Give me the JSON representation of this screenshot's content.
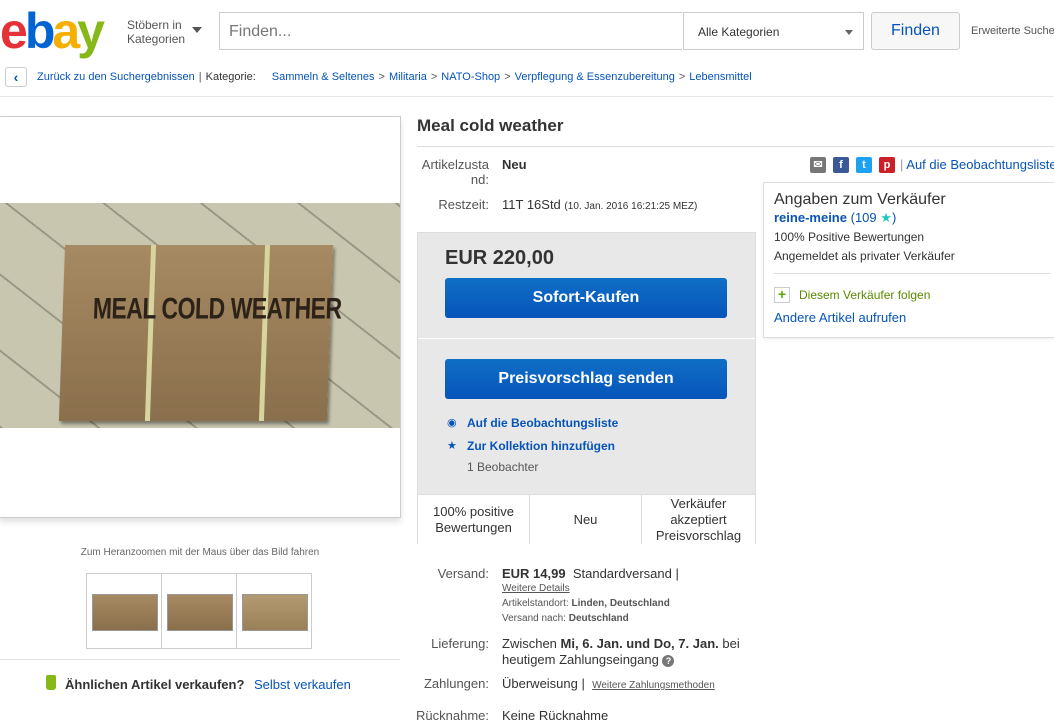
{
  "header": {
    "browse_label_1": "Stöbern in",
    "browse_label_2": "Kategorien",
    "search_placeholder": "Finden...",
    "category_select": "Alle Kategorien",
    "find_button": "Finden",
    "advanced_link": "Erweiterte Suche"
  },
  "breadcrumb": {
    "back_link": "Zurück zu den Suchergebnissen",
    "category_label": "Kategorie:",
    "items": [
      "Sammeln & Seltenes",
      "Militaria",
      "NATO-Shop",
      "Verpflegung & Essenzubereitung",
      "Lebensmittel"
    ]
  },
  "gallery": {
    "main_image_text": "MEAL  COLD WEATHER",
    "zoom_hint": "Zum Heranzoomen mit der Maus über das Bild fahren",
    "sell_similar_label": "Ähnlichen Artikel verkaufen?",
    "sell_link": "Selbst verkaufen"
  },
  "item": {
    "title": "Meal cold weather",
    "condition_label_1": "Artikelzusta",
    "condition_label_2": "nd:",
    "condition_value": "Neu",
    "time_label": "Restzeit:",
    "time_value": "11T 16Std",
    "time_detail": "(10. Jan. 2016   16:21:25 MEZ)",
    "watchlist_link": "Auf die Beobachtungsliste"
  },
  "buybox": {
    "price": "EUR 220,00",
    "buy_now": "Sofort-Kaufen",
    "make_offer": "Preisvorschlag senden",
    "watch_link": "Auf die Beobachtungsliste",
    "collection_link": "Zur Kollektion hinzufügen",
    "watchers": "1 Beobachter",
    "features": [
      "100% positive Bewertungen",
      "Neu",
      "Verkäufer akzeptiert Preisvorschlag"
    ]
  },
  "seller": {
    "title": "Angaben zum Verkäufer",
    "name": "reine-meine",
    "feedback_count": "109",
    "positive": "100% Positive Bewertungen",
    "registered": "Angemeldet als privater Verkäufer",
    "follow": "Diesem Verkäufer folgen",
    "other_items": "Andere Artikel aufrufen"
  },
  "shipping": {
    "label": "Versand:",
    "price": "EUR 14,99",
    "type": "Standardversand |",
    "details_link": "Weitere Details",
    "location_label": "Artikelstandort:",
    "location": "Linden, Deutschland",
    "ship_to_label": "Versand nach:",
    "ship_to": "Deutschland",
    "delivery_label": "Lieferung:",
    "delivery_1": "Zwischen",
    "delivery_dates": "Mi, 6. Jan. und Do, 7. Jan.",
    "delivery_2": "bei",
    "delivery_3": "heutigem Zahlungseingang",
    "payment_label": "Zahlungen:",
    "payment_value": "Überweisung |",
    "payment_link": "Weitere Zahlungsmethoden",
    "returns_label": "Rücknahme:",
    "returns_value": "Keine Rücknahme"
  },
  "colors": {
    "link": "#0654ba",
    "button": "#0654ba",
    "star": "#1ec7bd"
  }
}
